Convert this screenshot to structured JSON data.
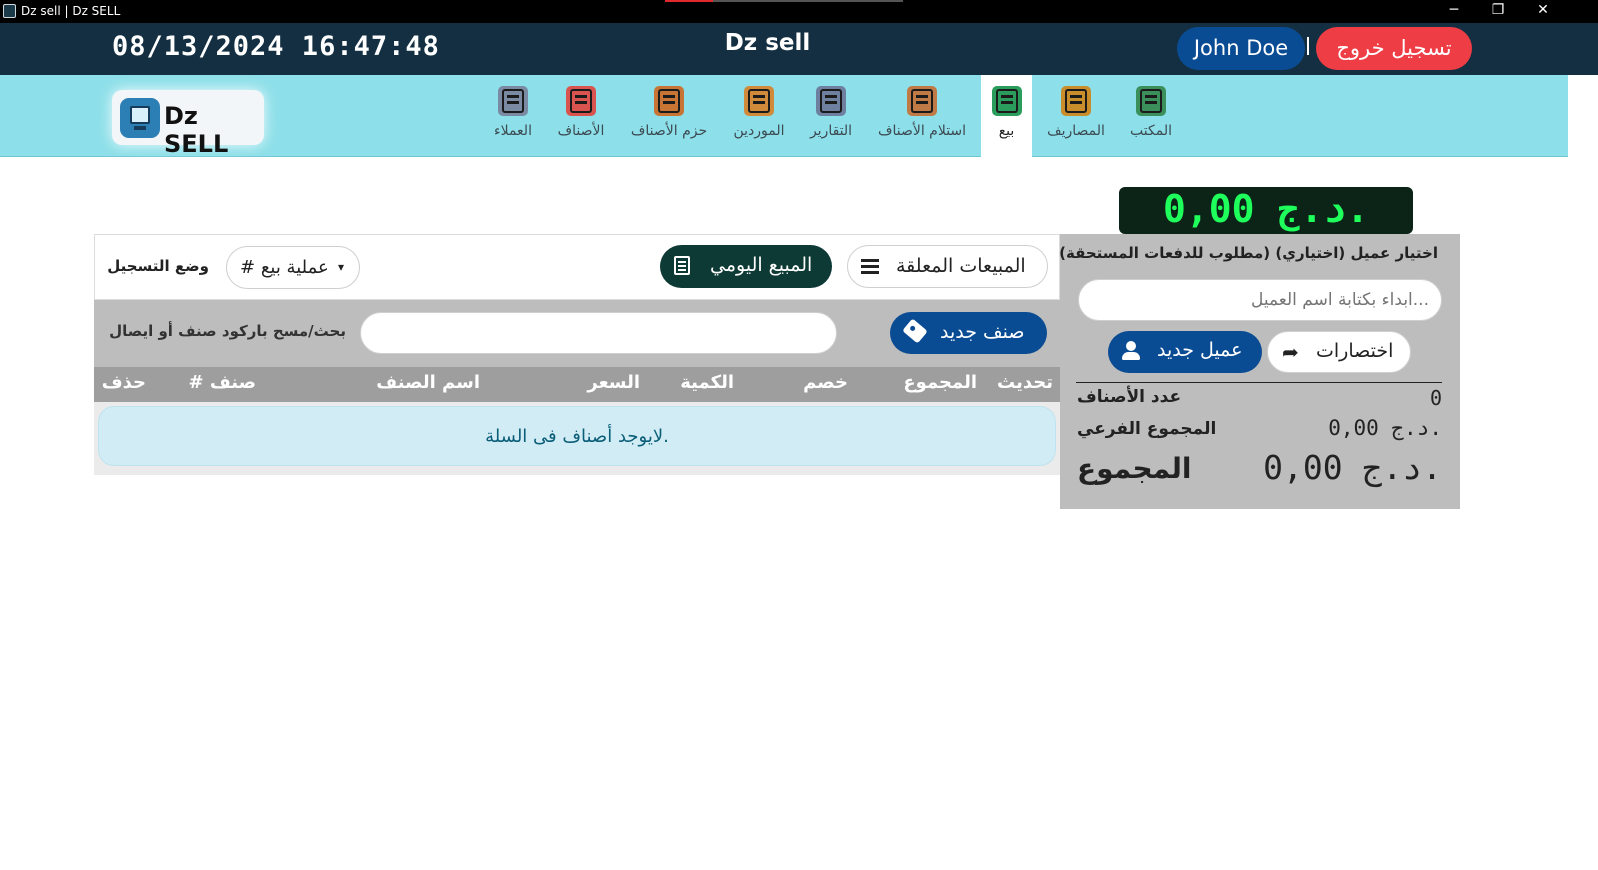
{
  "window": {
    "title": "Dz sell | Dz SELL",
    "minimize": "─",
    "maximize": "❐",
    "close": "✕"
  },
  "header": {
    "datetime": "08/13/2024 16:47:48",
    "app_title": "Dz sell",
    "user_name": "John Doe",
    "separator": "|",
    "logout_label": "تسجيل خروج"
  },
  "logo": {
    "text": "Dz SELL",
    "icon": "monitor-icon"
  },
  "nav": {
    "items": [
      {
        "label": "المكتب",
        "icon": "office-icon",
        "color": "#3a8f5a"
      },
      {
        "label": "المصاريف",
        "icon": "wallet-icon",
        "color": "#c98d2b"
      },
      {
        "label": "بيع",
        "icon": "sell-icon",
        "color": "#2a9d5c",
        "active": true
      },
      {
        "label": "استلام الأصناف",
        "icon": "receive-items-icon",
        "color": "#c07a45"
      },
      {
        "label": "التقارير",
        "icon": "reports-icon",
        "color": "#6e7fa0"
      },
      {
        "label": "الموردين",
        "icon": "suppliers-icon",
        "color": "#d08a3a"
      },
      {
        "label": "حزم الأصناف",
        "icon": "packages-icon",
        "color": "#c77434"
      },
      {
        "label": "الأصناف",
        "icon": "products-icon",
        "color": "#d9534f"
      },
      {
        "label": "العملاء",
        "icon": "customers-icon",
        "color": "#7a8aa3"
      }
    ]
  },
  "display": {
    "amount": "0,00 د.ج."
  },
  "toolbar": {
    "pending_label": "المبيعات المعلقة",
    "daily_label": "المبيع اليومي",
    "mode_value": "# عملية بيع",
    "mode_caret": "▾",
    "mode_label": "وضع التسجيل"
  },
  "search": {
    "new_item_label": "صنف جديد",
    "placeholder": "",
    "label": "بحث/مسح باركود صنف أو ايصال"
  },
  "table": {
    "columns": [
      "تحديث",
      "المجموع",
      "خصم",
      "الكمية",
      "السعر",
      "اسم الصنف",
      "# صنف",
      "حذف"
    ],
    "empty_message": "لايوجد أصناف فى السلة."
  },
  "customer": {
    "label": "اختيار عميل (اختياري) (مطلوب للدفعات المستحقة)",
    "placeholder": "ابداء بكتابة اسم العميل...",
    "shortcuts_label": "اختصارات",
    "new_customer_label": "عميل جديد"
  },
  "summary": {
    "items_count_label": "عدد الأصناف",
    "items_count": "0",
    "subtotal_label": "المجموع الفرعي",
    "subtotal": "0,00 د.ج.",
    "total_label": "المجموع",
    "total": "0,00 د.ج."
  }
}
